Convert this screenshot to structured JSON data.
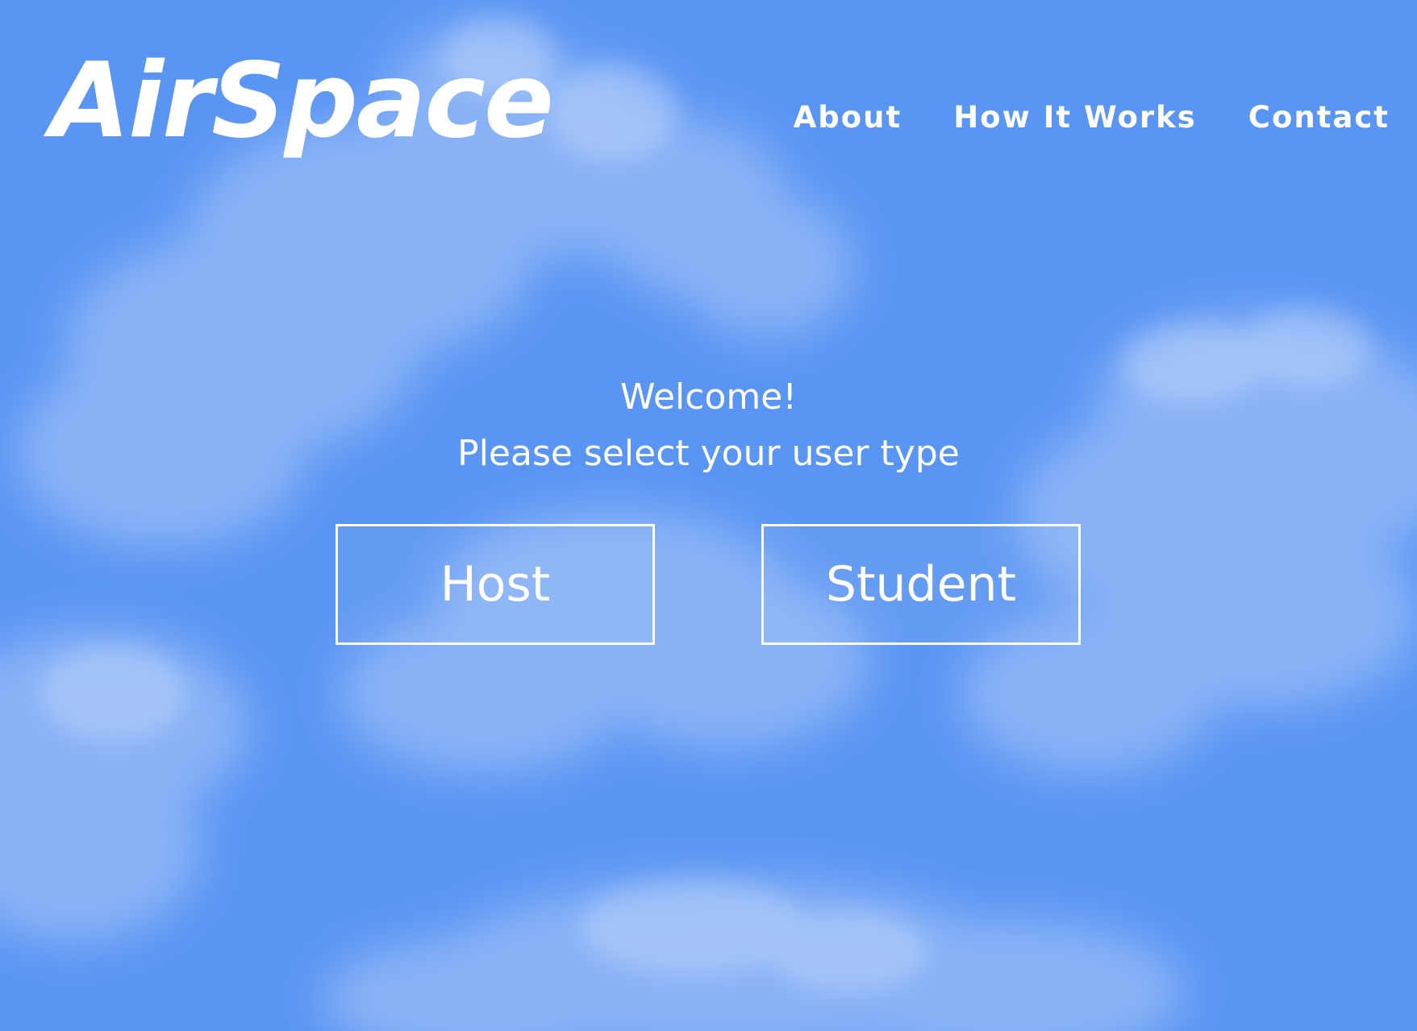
{
  "header": {
    "logo_text": "AirSpace",
    "nav": [
      {
        "label": "About"
      },
      {
        "label": "How It Works"
      },
      {
        "label": "Contact"
      }
    ]
  },
  "main": {
    "welcome_line1": "Welcome!",
    "welcome_line2": "Please select your user type",
    "options": [
      {
        "label": "Host"
      },
      {
        "label": "Student"
      }
    ]
  },
  "colors": {
    "sky": "#5b95f3",
    "text": "#ffffff"
  }
}
